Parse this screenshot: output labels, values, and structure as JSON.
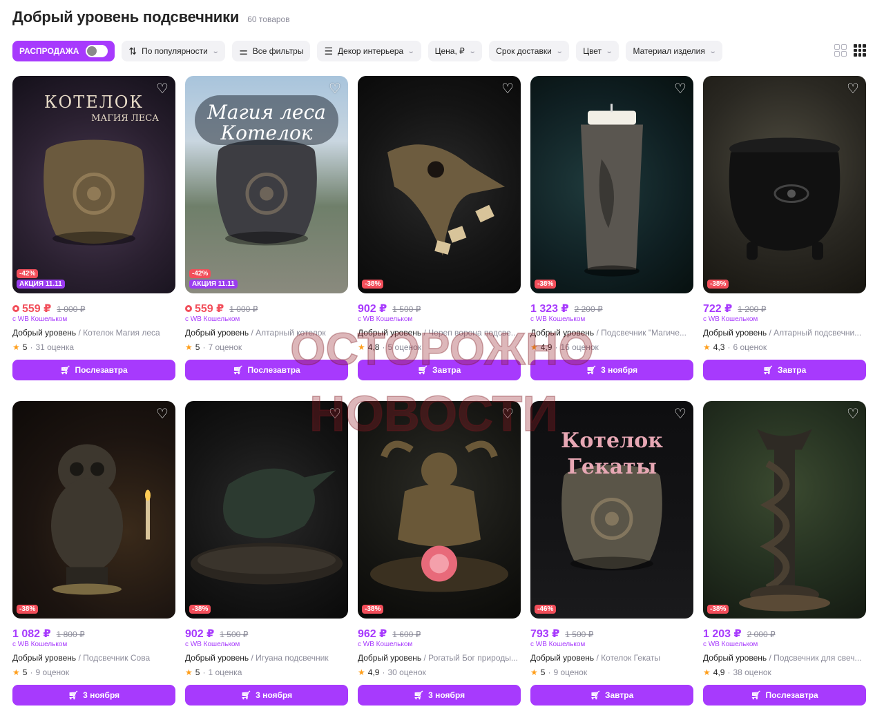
{
  "page": {
    "title": "Добрый уровень подсвечники",
    "count": "60 товаров"
  },
  "filters": {
    "sale_label": "РАСПРОДАЖА",
    "sort_label": "По популярности",
    "all_filters_label": "Все фильтры",
    "category_label": "Декор интерьера",
    "price_label": "Цена, ₽",
    "delivery_label": "Срок доставки",
    "color_label": "Цвет",
    "material_label": "Материал изделия"
  },
  "colors": {
    "accent": "#a73afd",
    "discount": "#f24e5a",
    "promo": "#9b3cf0",
    "star": "#ff9e1a"
  },
  "watermark": {
    "line1": "ОСТОРОЖНО",
    "line2": "НОВОСТИ"
  },
  "products": [
    {
      "price": "559 ₽",
      "old_price": "1 000 ₽",
      "wallet": "с WB Кошельком",
      "brand": "Добрый уровень",
      "name": "Котелок Магия леса",
      "rating": "5",
      "reviews": "31 оценка",
      "discount": "-42%",
      "promo": "АКЦИЯ 11.11",
      "delivery": "Послезавтра",
      "caption1": "КОТЕЛОК",
      "caption2": "МАГИЯ ЛЕСА"
    },
    {
      "price": "559 ₽",
      "old_price": "1 000 ₽",
      "wallet": "с WB Кошельком",
      "brand": "Добрый уровень",
      "name": "Алтарный котелок",
      "rating": "5",
      "reviews": "7 оценок",
      "discount": "-42%",
      "promo": "АКЦИЯ 11.11",
      "delivery": "Послезавтра",
      "caption1": "Магия леса",
      "caption2": "Котелок"
    },
    {
      "price": "902 ₽",
      "old_price": "1 500 ₽",
      "wallet": "с WB Кошельком",
      "brand": "Добрый уровень",
      "name": "Череп ворона подсве...",
      "rating": "4,8",
      "reviews": "5 оценок",
      "discount": "-38%",
      "delivery": "Завтра"
    },
    {
      "price": "1 323 ₽",
      "old_price": "2 200 ₽",
      "wallet": "с WB Кошельком",
      "brand": "Добрый уровень",
      "name": "Подсвечник \"Магиче...",
      "rating": "4,9",
      "reviews": "16 оценок",
      "discount": "-38%",
      "delivery": "3 ноября"
    },
    {
      "price": "722 ₽",
      "old_price": "1 200 ₽",
      "wallet": "с WB Кошельком",
      "brand": "Добрый уровень",
      "name": "Алтарный подсвечни...",
      "rating": "4,3",
      "reviews": "6 оценок",
      "discount": "-38%",
      "delivery": "Завтра"
    },
    {
      "price": "1 082 ₽",
      "old_price": "1 800 ₽",
      "wallet": "с WB Кошельком",
      "brand": "Добрый уровень",
      "name": "Подсвечник Сова",
      "rating": "5",
      "reviews": "9 оценок",
      "discount": "-38%",
      "delivery": "3 ноября"
    },
    {
      "price": "902 ₽",
      "old_price": "1 500 ₽",
      "wallet": "с WB Кошельком",
      "brand": "Добрый уровень",
      "name": "Игуана подсвечник",
      "rating": "5",
      "reviews": "1 оценка",
      "discount": "-38%",
      "delivery": "3 ноября"
    },
    {
      "price": "962 ₽",
      "old_price": "1 600 ₽",
      "wallet": "с WB Кошельком",
      "brand": "Добрый уровень",
      "name": "Рогатый Бог природы...",
      "rating": "4,9",
      "reviews": "30 оценок",
      "discount": "-38%",
      "delivery": "3 ноября"
    },
    {
      "price": "793 ₽",
      "old_price": "1 500 ₽",
      "wallet": "с WB Кошельком",
      "brand": "Добрый уровень",
      "name": "Котелок Гекаты",
      "rating": "5",
      "reviews": "9 оценок",
      "discount": "-46%",
      "delivery": "Завтра",
      "caption1": "Котелок",
      "caption2": "Гекаты"
    },
    {
      "price": "1 203 ₽",
      "old_price": "2 000 ₽",
      "wallet": "с WB Кошельком",
      "brand": "Добрый уровень",
      "name": "Подсвечник для свеч...",
      "rating": "4,9",
      "reviews": "38 оценок",
      "discount": "-38%",
      "delivery": "Послезавтра"
    }
  ]
}
